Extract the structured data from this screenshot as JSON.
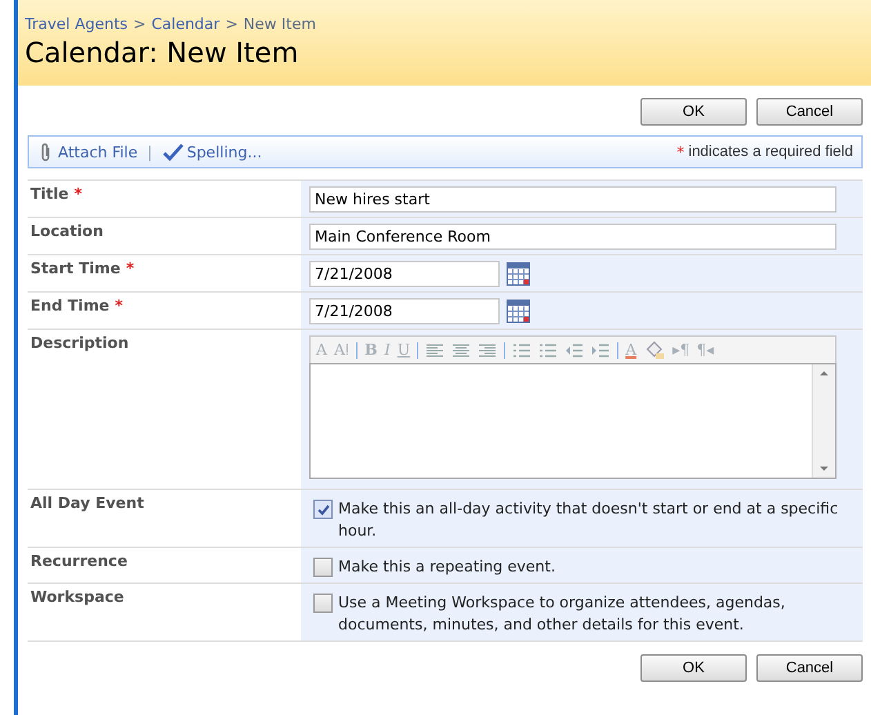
{
  "breadcrumb": [
    "Travel Agents",
    "Calendar",
    "New Item"
  ],
  "breadcrumb_separator": ">",
  "page_title": "Calendar: New Item",
  "top_buttons": [
    "OK",
    "Cancel"
  ],
  "toolbar": {
    "attach": "Attach File",
    "separator": "|",
    "spelling": "Spelling...",
    "required_mark": "*",
    "required_note": "indicates a required field"
  },
  "fields": [
    {
      "kind": "text",
      "label": "Title",
      "required": true,
      "value": "New hires start"
    },
    {
      "kind": "text",
      "label": "Location",
      "required": false,
      "value": "Main Conference Room"
    },
    {
      "kind": "date",
      "label": "Start Time",
      "required": true,
      "value": "7/21/2008"
    },
    {
      "kind": "date",
      "label": "End Time",
      "required": true,
      "value": "7/21/2008"
    },
    {
      "kind": "richtext",
      "label": "Description",
      "required": false,
      "editor_toolbar": [
        {
          "kind": "text",
          "text": "A"
        },
        {
          "kind": "text",
          "text": "Aǃ"
        },
        {
          "kind": "sep"
        },
        {
          "kind": "bold",
          "text": "B"
        },
        {
          "kind": "italic",
          "text": "I"
        },
        {
          "kind": "underline",
          "text": "U"
        },
        {
          "kind": "sep"
        },
        {
          "kind": "align-left"
        },
        {
          "kind": "align-center"
        },
        {
          "kind": "align-right"
        },
        {
          "kind": "sep"
        },
        {
          "kind": "numbered-list"
        },
        {
          "kind": "bullet-list"
        },
        {
          "kind": "outdent"
        },
        {
          "kind": "indent"
        },
        {
          "kind": "sep"
        },
        {
          "kind": "font-color",
          "text": "A"
        },
        {
          "kind": "highlight"
        },
        {
          "kind": "text",
          "text": "▸¶"
        },
        {
          "kind": "text",
          "text": "¶◂"
        }
      ]
    },
    {
      "kind": "checkbox",
      "label": "All Day Event",
      "required": false,
      "checked": true,
      "text": "Make this an all-day activity that doesn't start or end at a specific hour."
    },
    {
      "kind": "checkbox",
      "label": "Recurrence",
      "required": false,
      "checked": false,
      "text": "Make this a repeating event."
    },
    {
      "kind": "checkbox",
      "label": "Workspace",
      "required": false,
      "checked": false,
      "text": "Use a Meeting Workspace to organize attendees, agendas, documents, minutes, and other details for this event."
    }
  ],
  "bottom_buttons": [
    "OK",
    "Cancel"
  ]
}
